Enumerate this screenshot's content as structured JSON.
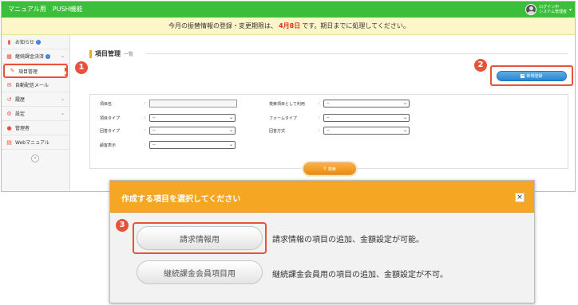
{
  "header": {
    "app_title": "マニュアル用　PUSH機能",
    "user_status": "ログイン中",
    "user_name": "システム管理者",
    "user_caret": "▾"
  },
  "notice": {
    "before": "今月の振替情報の登録・変更期限は、",
    "date": "4月8日",
    "after": "です。期日までに処理してください。"
  },
  "sidebar": {
    "items": [
      {
        "label": "お知らせ",
        "icon": "chart-icon"
      },
      {
        "label": "継続課金決済",
        "icon": "calendar-icon"
      },
      {
        "label": "項目管理",
        "icon": "tags-icon"
      },
      {
        "label": "自動配信メール",
        "icon": "mail-icon"
      },
      {
        "label": "履歴",
        "icon": "history-icon"
      },
      {
        "label": "設定",
        "icon": "gear-icon"
      },
      {
        "label": "管理者",
        "icon": "person-icon"
      },
      {
        "label": "Webマニュアル",
        "icon": "book-icon"
      }
    ],
    "info_glyph": "i",
    "chevron_glyph": "⌄",
    "arrow_glyph": "◀",
    "collapse_glyph": "«"
  },
  "markers": [
    "1",
    "2",
    "3"
  ],
  "main": {
    "title": "項目管理",
    "subtitle": "一覧",
    "new_button": "新規登録",
    "search_button": "検索",
    "fields": {
      "item_name": "項目名",
      "search_use": "検索項目として利用",
      "item_type": "項目タイプ",
      "form_type": "フォームタイプ",
      "answer_type": "回答タイプ",
      "answer_method": "回答方式",
      "customer_display": "顧客表示"
    },
    "select_value": "--",
    "colon": ":"
  },
  "modal": {
    "title": "作成する項目を選択してください",
    "close": "×",
    "options": [
      {
        "label": "請求情報用",
        "desc": "請求情報の項目の追加、金額設定が可能。"
      },
      {
        "label": "継続課金会員項目用",
        "desc": "継続課金会員用の項目の追加、金額設定が不可。"
      }
    ]
  },
  "colors": {
    "accent_green": "#3bbf3b",
    "accent_orange": "#f5a623",
    "highlight_red": "#e8523a",
    "button_blue": "#2b86cf"
  }
}
